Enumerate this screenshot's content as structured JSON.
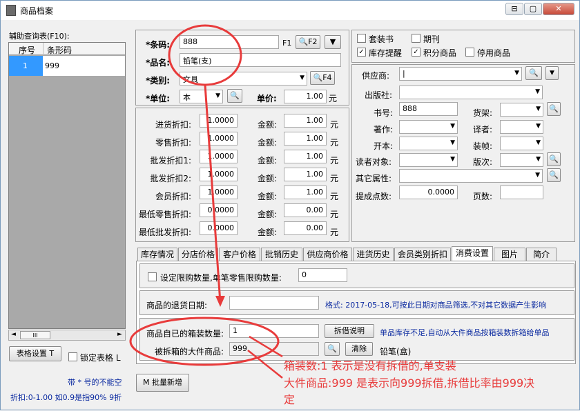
{
  "window": {
    "title": "商品档案",
    "btn_min": "⊟",
    "btn_max": "▢",
    "btn_close": "✕"
  },
  "left": {
    "lookup_label": "辅助查询表(F10):",
    "col_seq": "序号",
    "col_barcode": "条形码",
    "rows": [
      {
        "seq": "1",
        "barcode": "999"
      }
    ],
    "scroll_left": "◄",
    "scroll_thumb": "III",
    "scroll_right": "►",
    "table_settings_btn": "表格设置 T",
    "lock_table_label": "锁定表格 L",
    "note_required": "带 * 号的不能空",
    "note_discount": "折扣:0-1.00 如0.9是指90%  9折",
    "batch_add_btn": "M 批量新增"
  },
  "basic": {
    "barcode_label": "*条码:",
    "barcode_value": "888",
    "f1": "F1",
    "f2_btn": "F2",
    "name_label": "*品名:",
    "name_value": "铅笔(支)",
    "category_label": "*类别:",
    "category_value": "文具",
    "f4_btn": "F4",
    "unit_label": "*单位:",
    "unit_value": "本",
    "price_label": "单价:",
    "price_value": "1.00",
    "yuan": "元"
  },
  "discounts": [
    {
      "label": "进货折扣:",
      "rate": "1.0000",
      "amount_label": "金额:",
      "amount": "1.00"
    },
    {
      "label": "零售折扣:",
      "rate": "1.0000",
      "amount_label": "金额:",
      "amount": "1.00"
    },
    {
      "label": "批发折扣1:",
      "rate": "1.0000",
      "amount_label": "金额:",
      "amount": "1.00"
    },
    {
      "label": "批发折扣2:",
      "rate": "1.0000",
      "amount_label": "金额:",
      "amount": "1.00"
    },
    {
      "label": "会员折扣:",
      "rate": "1.0000",
      "amount_label": "金额:",
      "amount": "1.00"
    },
    {
      "label": "最低零售折扣:",
      "rate": "0.0000",
      "amount_label": "金额:",
      "amount": "0.00"
    },
    {
      "label": "最低批发折扣:",
      "rate": "0.0000",
      "amount_label": "金额:",
      "amount": "0.00"
    }
  ],
  "flags": {
    "set_book": "套装书",
    "periodical": "期刊",
    "stock_alert": "库存提醒",
    "points_item": "积分商品",
    "disabled_item": "停用商品"
  },
  "right": {
    "supplier_label": "供应商:",
    "supplier_value": "|",
    "publisher_label": "出版社:",
    "book_no_label": "书号:",
    "book_no_value": "888",
    "shelf_label": "货架:",
    "author_label": "著作:",
    "translator_label": "译者:",
    "format_label": "开本:",
    "binding_label": "装帧:",
    "readers_label": "读者对象:",
    "edition_label": "版次:",
    "other_attr_label": "其它属性:",
    "commission_label": "提成点数:",
    "commission_value": "0.0000",
    "pages_label": "页数:"
  },
  "tabs": [
    "库存情况",
    "分店价格",
    "客户价格",
    "批销历史",
    "供应商价格",
    "进货历史",
    "会员类别折扣",
    "消费设置",
    "图片",
    "简介"
  ],
  "consume": {
    "limit_label": "设定限购数量,单笔零售限购数量:",
    "limit_value": "0",
    "return_date_label": "商品的退货日期:",
    "format_note": "格式: 2017-05-18,可按此日期对商品筛选,不对其它数据产生影响",
    "box_qty_label": "商品自已的箱装数量:",
    "box_qty_value": "1",
    "split_help_btn": "拆借说明",
    "split_note": "单品库存不足,自动从大件商品按箱装数拆箱给单品",
    "big_item_label": "被拆箱的大件商品:",
    "big_item_value": "999",
    "clear_btn": "清除",
    "big_item_name": "铅笔(盒)"
  },
  "annotation": {
    "line1": "箱装数:1 表示是没有拆借的,单支装",
    "line2": "大件商品:999 是表示向999拆借,拆借比率由999决",
    "line3": "定",
    "color": "#e83b3b"
  }
}
